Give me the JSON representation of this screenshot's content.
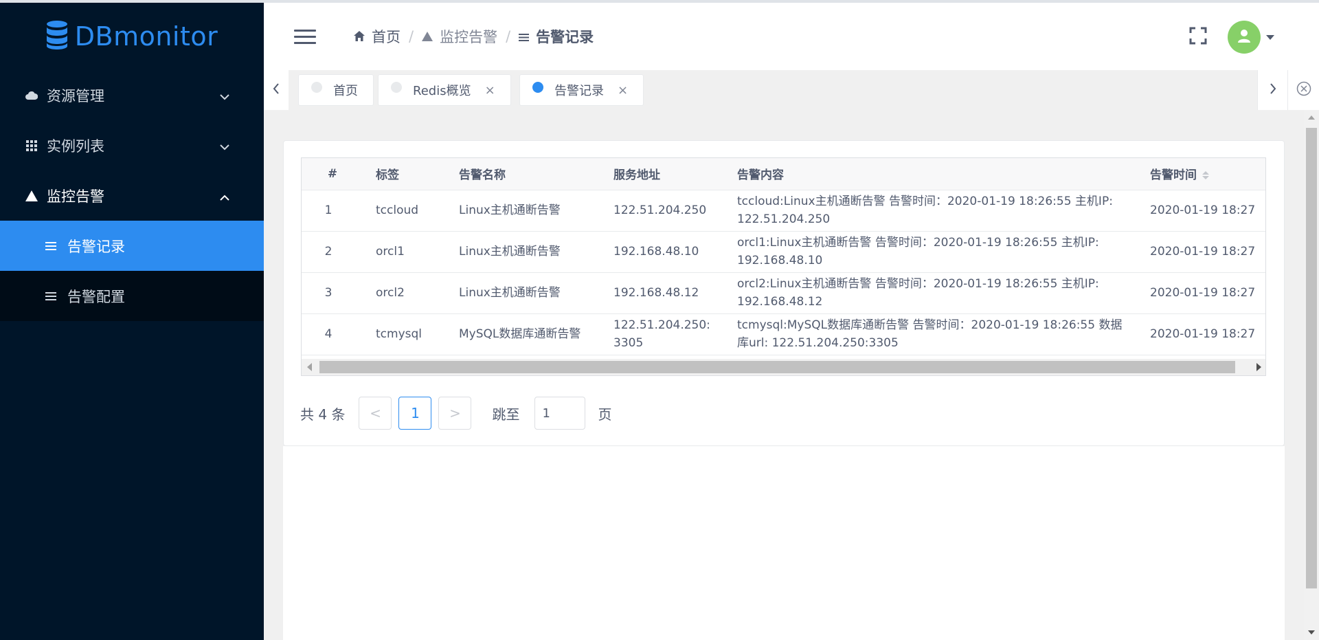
{
  "app": {
    "name": "DBmonitor"
  },
  "sidebar": {
    "items": [
      {
        "label": "资源管理",
        "icon": "cloud-icon"
      },
      {
        "label": "实例列表",
        "icon": "grid-icon"
      },
      {
        "label": "监控告警",
        "icon": "warning-icon"
      }
    ],
    "subitems": [
      {
        "label": "告警记录",
        "icon": "list-icon"
      },
      {
        "label": "告警配置",
        "icon": "list-icon"
      }
    ]
  },
  "breadcrumb": [
    {
      "label": "首页",
      "icon": "home-icon"
    },
    {
      "label": "监控告警",
      "icon": "warning-icon"
    },
    {
      "label": "告警记录",
      "icon": "list-icon"
    }
  ],
  "tabs": [
    {
      "label": "首页"
    },
    {
      "label": "Redis概览"
    },
    {
      "label": "告警记录"
    }
  ],
  "tabs_close": "×",
  "table": {
    "columns": [
      "#",
      "标签",
      "告警名称",
      "服务地址",
      "告警内容",
      "告警时间"
    ],
    "rows": [
      {
        "idx": "1",
        "tag": "tccloud",
        "name": "Linux主机通断告警",
        "addr": "122.51.204.250",
        "content": "tccloud:Linux主机通断告警 告警时间：2020-01-19 18:26:55 主机IP: 122.51.204.250",
        "time": "2020-01-19 18:27"
      },
      {
        "idx": "2",
        "tag": "orcl1",
        "name": "Linux主机通断告警",
        "addr": "192.168.48.10",
        "content": "orcl1:Linux主机通断告警 告警时间：2020-01-19 18:26:55 主机IP: 192.168.48.10",
        "time": "2020-01-19 18:27"
      },
      {
        "idx": "3",
        "tag": "orcl2",
        "name": "Linux主机通断告警",
        "addr": "192.168.48.12",
        "content": "orcl2:Linux主机通断告警 告警时间：2020-01-19 18:26:55 主机IP: 192.168.48.12",
        "time": "2020-01-19 18:27"
      },
      {
        "idx": "4",
        "tag": "tcmysql",
        "name": "MySQL数据库通断告警",
        "addr": "122.51.204.250:3305",
        "content": "tcmysql:MySQL数据库通断告警 告警时间：2020-01-19 18:26:55 数据库url: 122.51.204.250:3305",
        "time": "2020-01-19 18:27"
      }
    ]
  },
  "pager": {
    "total_text": "共 4 条",
    "current": "1",
    "prev": "<",
    "next": ">",
    "jump_label": "跳至",
    "jump_value": "1",
    "page_suffix": "页"
  },
  "colors": {
    "accent": "#2d8cf0",
    "sidebar_bg": "#001529",
    "avatar_bg": "#87d068"
  }
}
